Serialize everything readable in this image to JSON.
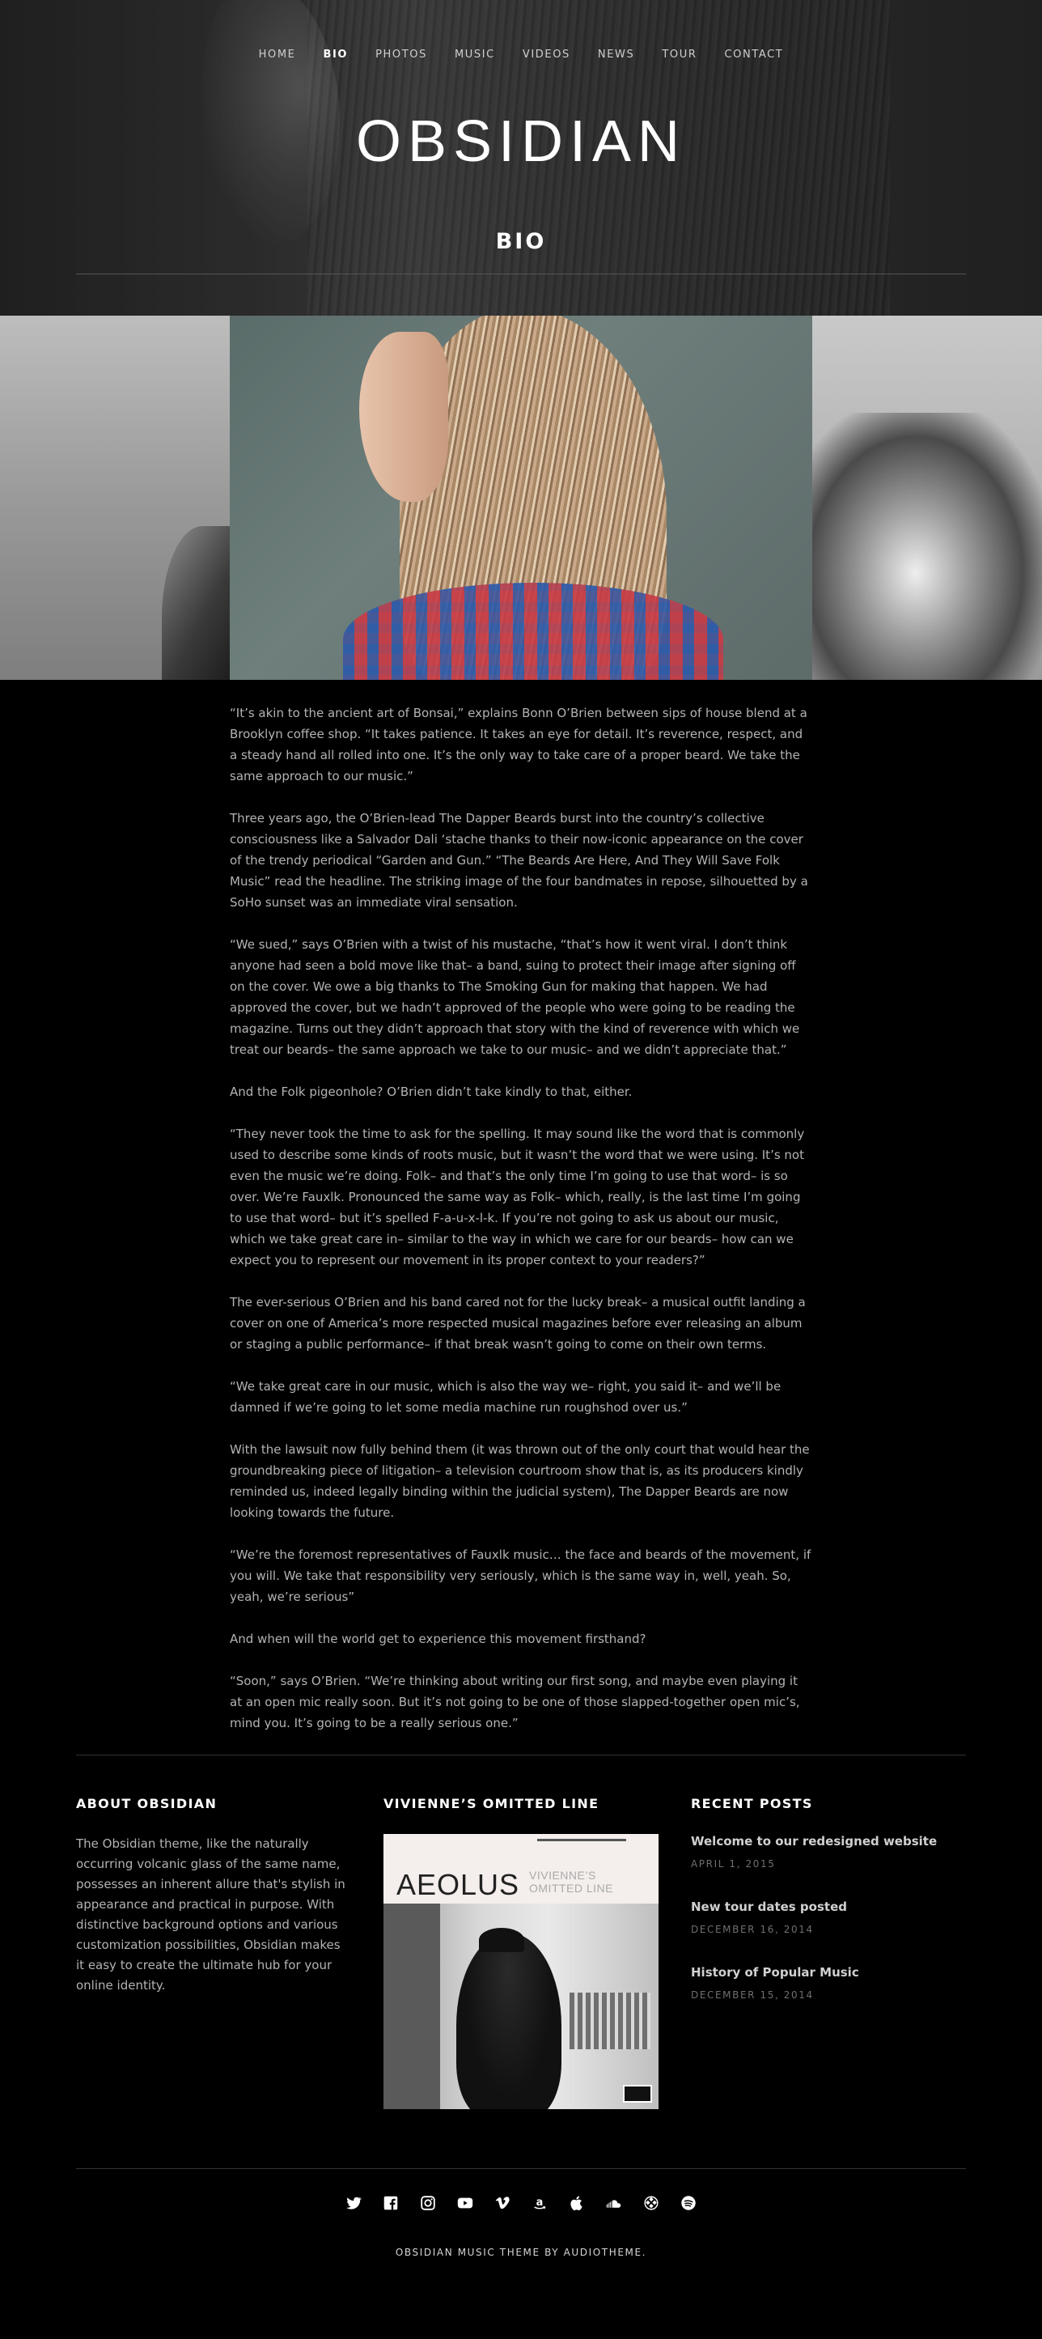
{
  "nav": {
    "items": [
      "HOME",
      "BIO",
      "PHOTOS",
      "MUSIC",
      "VIDEOS",
      "NEWS",
      "TOUR",
      "CONTACT"
    ],
    "active": "BIO"
  },
  "site_title": "OBSIDIAN",
  "page_title": "BIO",
  "bio": {
    "paragraphs": [
      "“It’s akin to the ancient art of Bonsai,” explains Bonn O’Brien between sips of house blend at a Brooklyn coffee shop. “It takes patience. It takes an eye for detail. It’s reverence, respect, and a steady hand all rolled into one. It’s the only way to take care of a proper beard. We take the same approach to our music.”",
      "Three years ago, the O’Brien-lead The Dapper Beards burst into the country’s collective consciousness like a Salvador Dali ‘stache thanks to their now-iconic appearance on the cover of the trendy periodical “Garden and Gun.” “The Beards Are Here, And They Will Save Folk Music” read the headline. The striking image of the four bandmates in repose, silhouetted by a SoHo sunset was an immediate viral sensation.",
      "“We sued,” says O’Brien with a twist of his mustache, “that’s how it went viral. I don’t think anyone had seen a bold move like that– a band, suing to protect their image after signing off on the cover. We owe a big thanks to The Smoking Gun for making that happen. We had approved the cover, but we hadn’t approved of the people who were going to be reading the magazine. Turns out they didn’t approach that story with the kind of reverence with which we treat our beards– the same approach we take to our music– and we didn’t appreciate that.”",
      "And the Folk pigeonhole? O’Brien didn’t take kindly to that, either.",
      "“They never took the time to ask for the spelling. It may sound like the word that is commonly used to describe some kinds of roots music, but it wasn’t the word that we were using. It’s not even the music we’re doing. Folk– and that’s the only time I’m going to use that word– is so over. We’re Fauxlk. Pronounced the same way as Folk– which, really, is the last time I’m going to use that word– but it’s spelled F-a-u-x-l-k. If you’re not going to ask us about our music, which we take great care in– similar to the way in which we care for our beards– how can we expect you to represent our movement in its proper context to your readers?”",
      "The ever-serious O’Brien and his band cared not for the lucky break– a musical outfit landing a cover on one of America’s more respected musical magazines before ever releasing an album or staging a public performance– if that break wasn’t going to come on their own terms.",
      "“We take great care in our music, which is also the way we– right, you said it– and we’ll be damned if we’re going to let some media machine run roughshod over us.”",
      "With the lawsuit now fully behind them (it was thrown out of the only court that would hear the groundbreaking piece of litigation– a television courtroom show that is, as its producers kindly reminded us, indeed legally binding within the judicial system), The Dapper Beards are now looking towards the future.",
      "“We’re the foremost representatives of Fauxlk music… the face and beards of the movement, if you will. We take that responsibility very seriously, which is the same way in, well, yeah. So, yeah, we’re serious”",
      "And when will the world get to experience this movement firsthand?",
      "“Soon,” says O’Brien. “We’re thinking about writing our first song, and maybe even playing it at an open mic really soon. But it’s not going to be one of those slapped-together open mic’s, mind you. It’s going to be a really serious one.”"
    ]
  },
  "widgets": {
    "about": {
      "title": "ABOUT OBSIDIAN",
      "text": "The Obsidian theme, like the naturally occurring volcanic glass of the same name, possesses an inherent allure that's stylish in appearance and practical in purpose. With distinctive background options and various customization possibilities, Obsidian makes it easy to create the ultimate hub for your online identity."
    },
    "album": {
      "title": "VIVIENNE’S OMITTED LINE",
      "cover_title": "AEOLUS",
      "cover_subtitle_1": "VIVIENNE’S",
      "cover_subtitle_2": "OMITTED LINE"
    },
    "recent": {
      "title": "RECENT POSTS",
      "posts": [
        {
          "title": "Welcome to our redesigned website",
          "date": "APRIL 1, 2015"
        },
        {
          "title": "New tour dates posted",
          "date": "DECEMBER 16, 2014"
        },
        {
          "title": "History of Popular Music",
          "date": "DECEMBER 15, 2014"
        }
      ]
    }
  },
  "social_icons": [
    "twitter-icon",
    "facebook-icon",
    "instagram-icon",
    "youtube-icon",
    "vimeo-icon",
    "amazon-icon",
    "apple-icon",
    "soundcloud-icon",
    "tidal-icon",
    "spotify-icon"
  ],
  "footer": {
    "credit": "OBSIDIAN MUSIC THEME BY AUDIOTHEME."
  }
}
